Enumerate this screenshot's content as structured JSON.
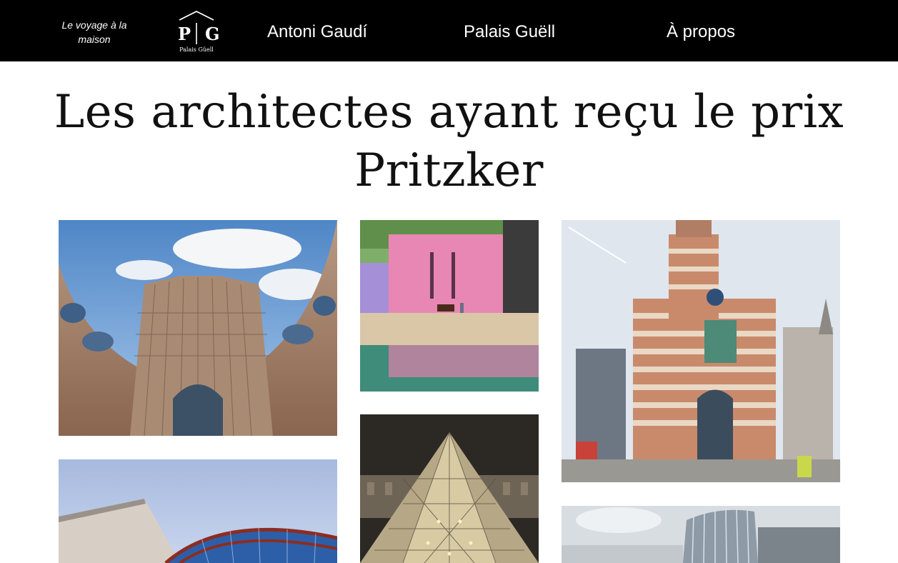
{
  "header": {
    "tagline": "Le voyage à la maison",
    "logo": {
      "letter_left": "P",
      "letter_right": "G",
      "caption": "Palais Güell"
    },
    "nav": [
      {
        "label": "Antoni Gaudí"
      },
      {
        "label": "Palais Guëll"
      },
      {
        "label": "À propos"
      }
    ]
  },
  "main": {
    "title": "Les architectes ayant reçu le prix Pritzker",
    "photos": [
      {
        "subject": "curved-stone-tower-building"
      },
      {
        "subject": "pink-wall-with-horse"
      },
      {
        "subject": "striped-postmodern-building"
      },
      {
        "subject": "glass-dome-building"
      },
      {
        "subject": "glass-pyramid-at-night"
      },
      {
        "subject": "curved-glass-facade"
      }
    ]
  },
  "colors": {
    "header_bg": "#000000",
    "header_text": "#ffffff",
    "page_bg": "#ffffff",
    "title_text": "#111111"
  }
}
